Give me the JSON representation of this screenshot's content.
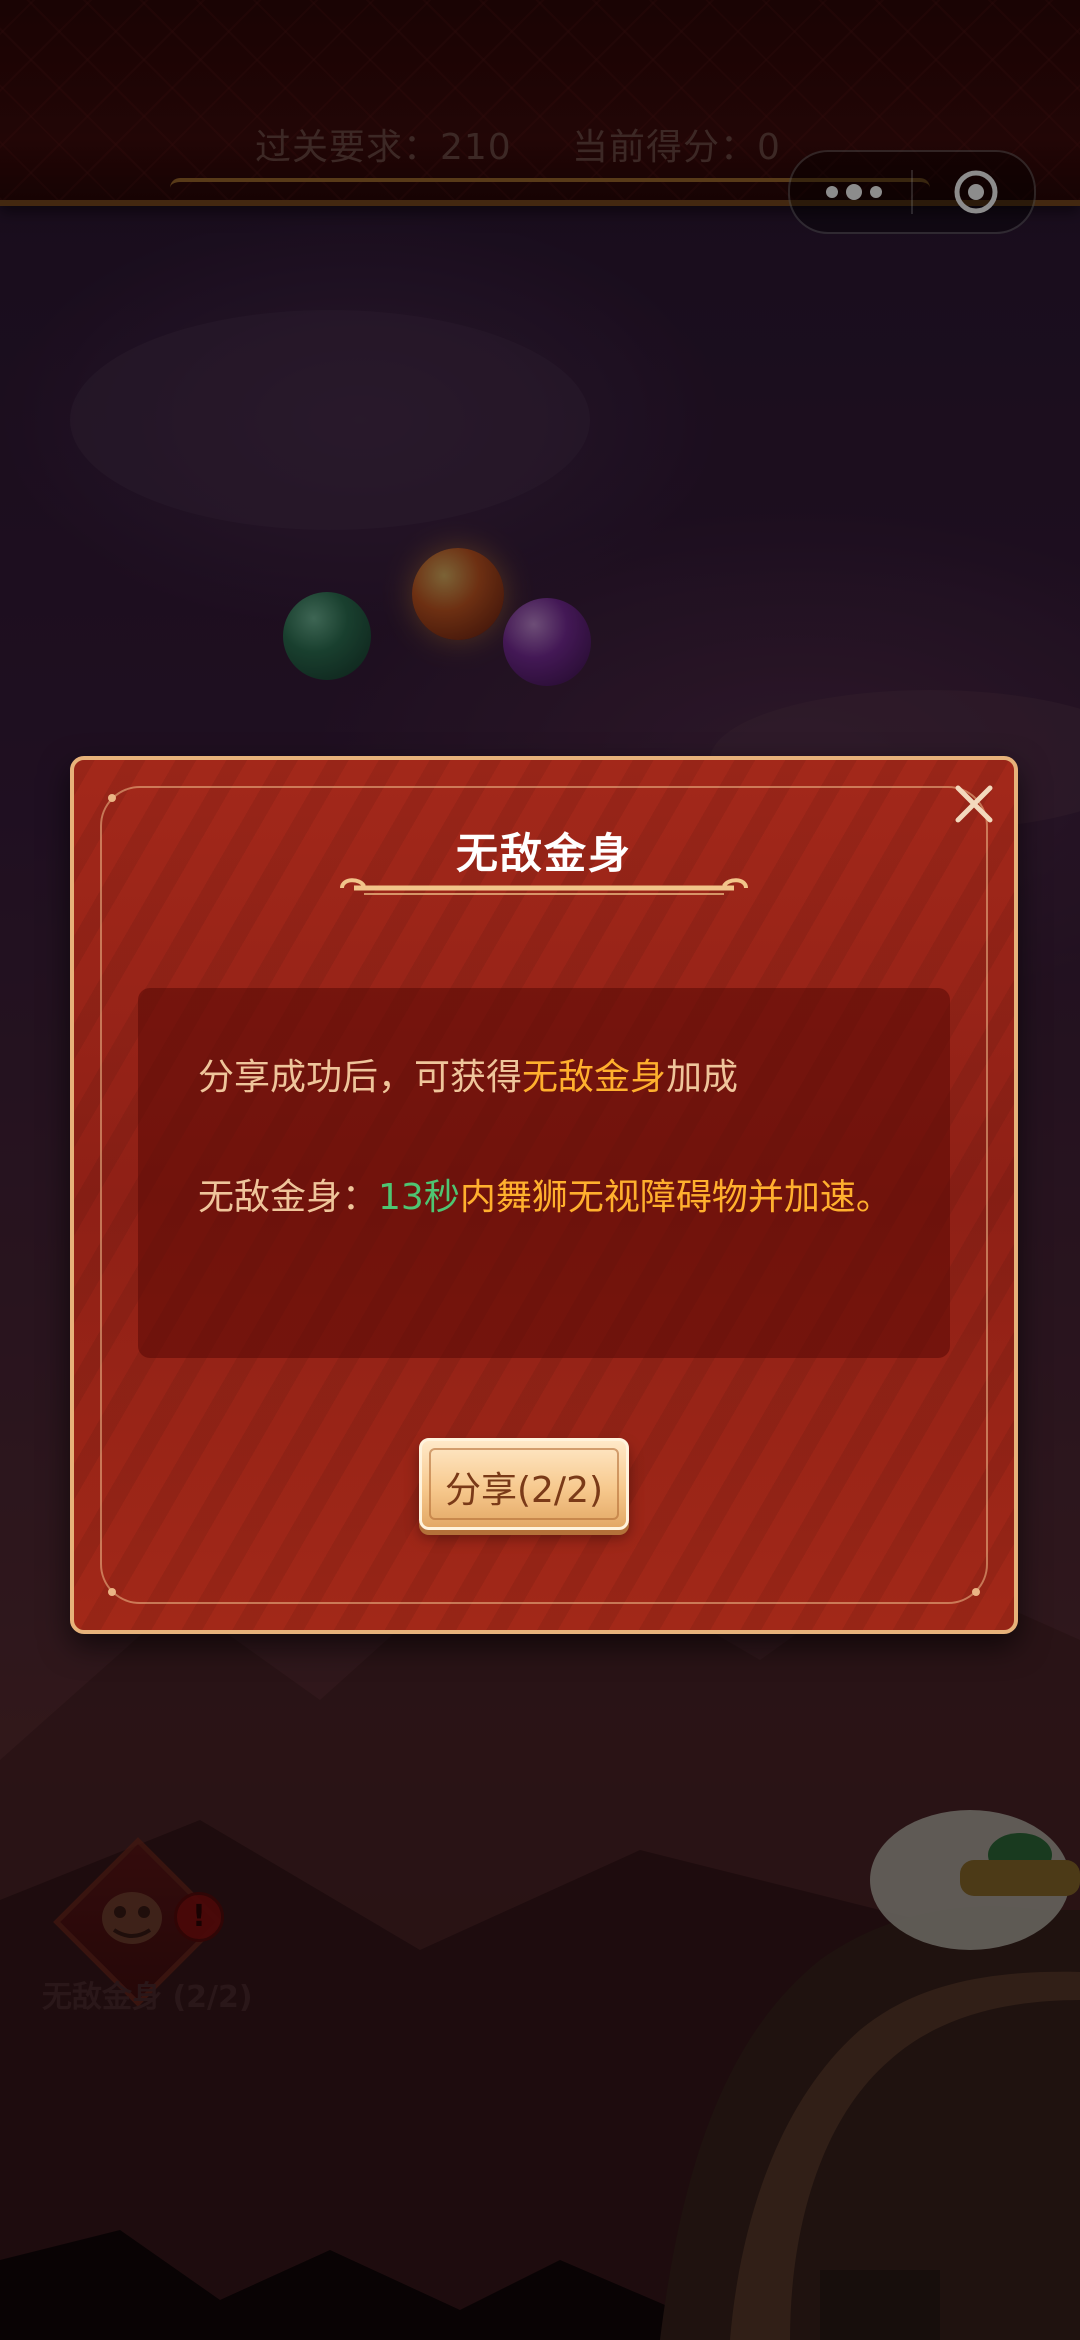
{
  "hud": {
    "requirement": "过关要求：210",
    "current_score": "当前得分：0"
  },
  "dialog": {
    "title": "无敌金身",
    "line1_pre": "分享成功后，可获得",
    "line1_highlight": "无敌金身",
    "line1_post": "加成",
    "line2_pre": "无敌金身：",
    "line2_seconds": "13秒",
    "line2_post": "内舞狮无视障碍物并加速。",
    "share_button": "分享(2/2)"
  },
  "buff_badge": {
    "label": "无敌金身 (2/2)",
    "alert": "!"
  },
  "colors": {
    "dialog_bg": "#981f16",
    "highlight_orange": "#ffb02e",
    "highlight_green": "#4ec572",
    "text": "#efc59b"
  },
  "icons": [
    "more-dots-icon",
    "mini-program-close-icon",
    "dialog-close-icon",
    "lion-head-icon",
    "alert-icon"
  ]
}
